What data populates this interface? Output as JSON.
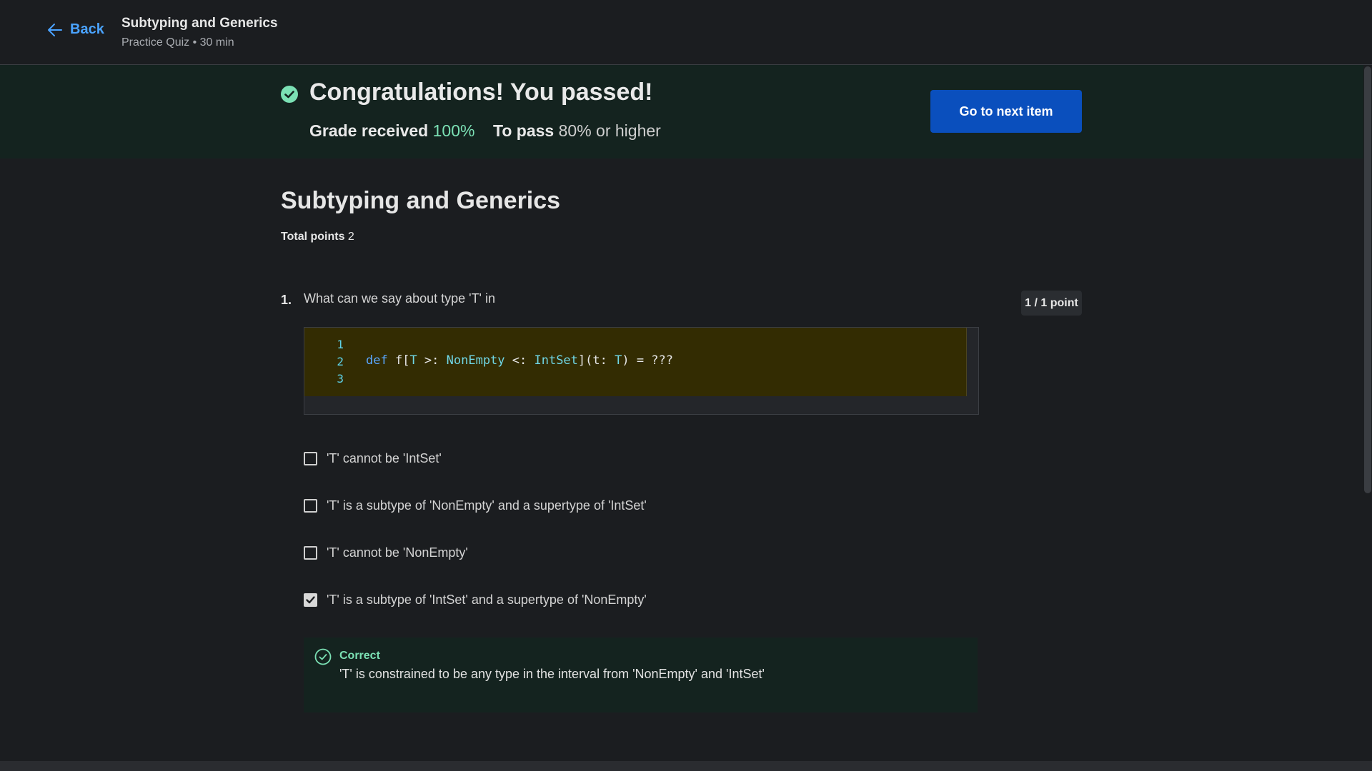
{
  "header": {
    "back_label": "Back",
    "title": "Subtyping and Generics",
    "subtitle": "Practice Quiz • 30 min"
  },
  "banner": {
    "title": "Congratulations! You passed!",
    "grade_label": "Grade received",
    "grade_value": "100%",
    "pass_label": "To pass",
    "pass_value": "80% or higher",
    "next_button": "Go to next item",
    "accent": "#7be0b4"
  },
  "main": {
    "title": "Subtyping and Generics",
    "total_points_label": "Total points",
    "total_points_value": "2"
  },
  "question": {
    "number": "1.",
    "text": "What can we say about type 'T' in",
    "score": "1 / 1 point",
    "code_line_numbers": [
      "1",
      "2",
      "3"
    ],
    "code": {
      "kw_def": "def",
      "p1": " f[",
      "t1": "T",
      "p2": " >: ",
      "t2": "NonEmpty",
      "p3": " <: ",
      "t3": "IntSet",
      "p4": "](t: ",
      "t4": "T",
      "p5": ") = ???"
    },
    "options": [
      {
        "label": "'T' cannot be 'IntSet'",
        "checked": false
      },
      {
        "label": "'T' is a subtype of 'NonEmpty' and a supertype of 'IntSet'",
        "checked": false
      },
      {
        "label": "'T' cannot be 'NonEmpty'",
        "checked": false
      },
      {
        "label": "'T' is a subtype of 'IntSet' and a supertype of 'NonEmpty'",
        "checked": true
      }
    ],
    "feedback": {
      "title": "Correct",
      "text": "'T' is constrained to be any type in the interval from 'NonEmpty' and 'IntSet'"
    }
  }
}
